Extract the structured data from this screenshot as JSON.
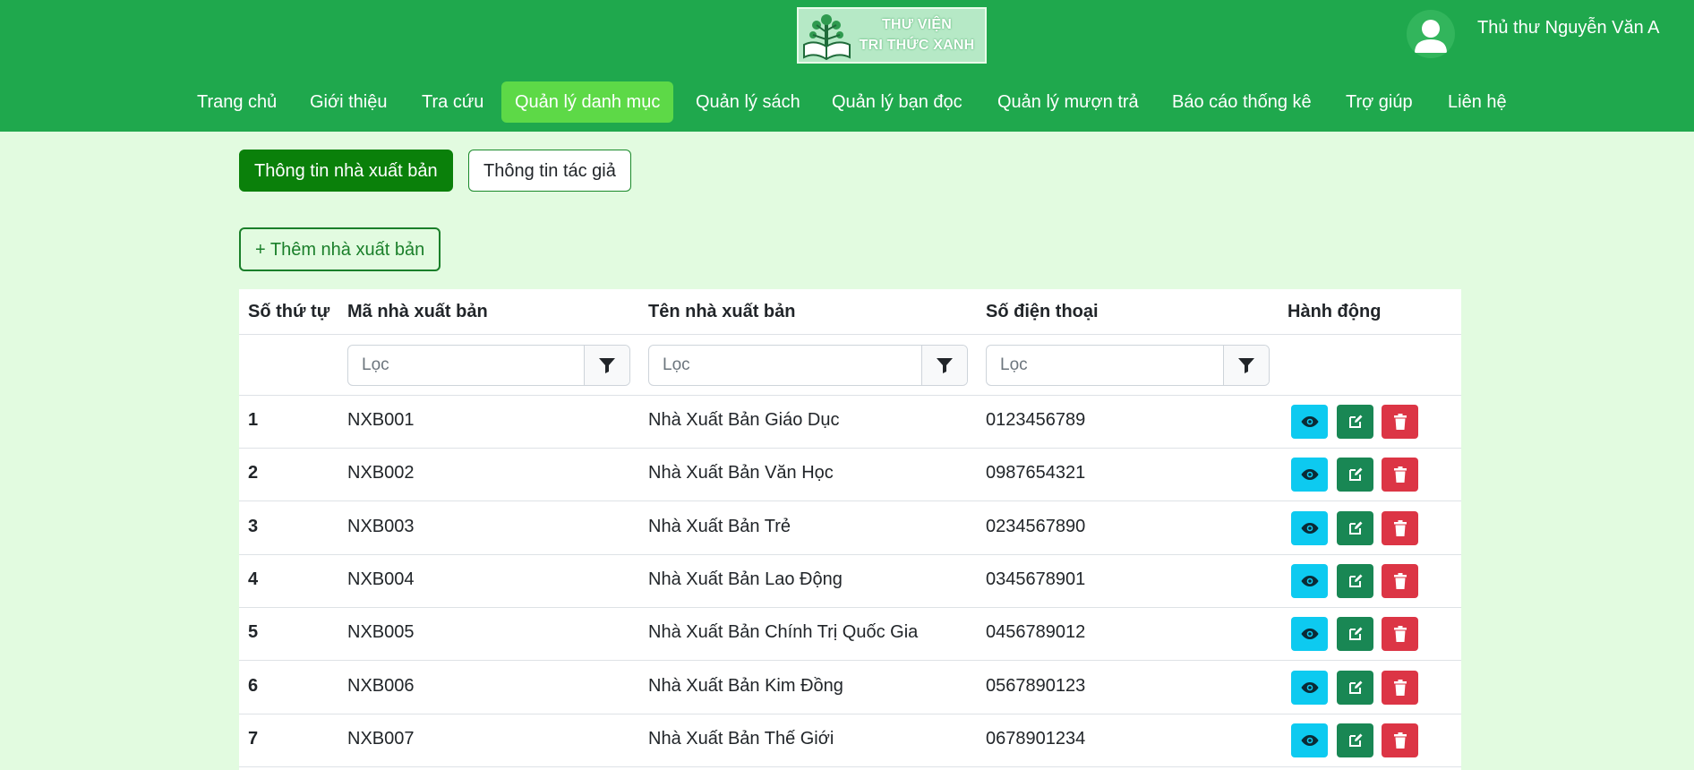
{
  "header": {
    "logo": {
      "line1": "THƯ VIỆN",
      "line2": "TRI THỨC XANH"
    },
    "user_name": "Thủ thư Nguyễn Văn A",
    "nav": [
      {
        "label": "Trang chủ",
        "active": false
      },
      {
        "label": "Giới thiệu",
        "active": false
      },
      {
        "label": "Tra cứu",
        "active": false
      },
      {
        "label": "Quản lý danh mục",
        "active": true
      },
      {
        "label": "Quản lý sách",
        "active": false
      },
      {
        "label": "Quản lý bạn đọc",
        "active": false
      },
      {
        "label": "Quản lý mượn trả",
        "active": false
      },
      {
        "label": "Báo cáo thống kê",
        "active": false
      },
      {
        "label": "Trợ giúp",
        "active": false
      },
      {
        "label": "Liên hệ",
        "active": false
      }
    ]
  },
  "tabs": {
    "publisher_info": "Thông tin nhà xuất bản",
    "author_info": "Thông tin tác giả"
  },
  "add_button": "+ Thêm nhà xuất bản",
  "table": {
    "columns": [
      "Số thứ tự",
      "Mã nhà xuất bản",
      "Tên nhà xuất bản",
      "Số điện thoại",
      "Hành động"
    ],
    "filter_placeholder": "Lọc",
    "rows": [
      {
        "stt": "1",
        "code": "NXB001",
        "name": "Nhà Xuất Bản Giáo Dục",
        "phone": "0123456789"
      },
      {
        "stt": "2",
        "code": "NXB002",
        "name": "Nhà Xuất Bản Văn Học",
        "phone": "0987654321"
      },
      {
        "stt": "3",
        "code": "NXB003",
        "name": "Nhà Xuất Bản Trẻ",
        "phone": "0234567890"
      },
      {
        "stt": "4",
        "code": "NXB004",
        "name": "Nhà Xuất Bản Lao Động",
        "phone": "0345678901"
      },
      {
        "stt": "5",
        "code": "NXB005",
        "name": "Nhà Xuất Bản Chính Trị Quốc Gia",
        "phone": "0456789012"
      },
      {
        "stt": "6",
        "code": "NXB006",
        "name": "Nhà Xuất Bản Kim Đồng",
        "phone": "0567890123"
      },
      {
        "stt": "7",
        "code": "NXB007",
        "name": "Nhà Xuất Bản Thế Giới",
        "phone": "0678901234"
      }
    ]
  },
  "icons": {
    "view": "eye-icon",
    "edit": "edit-icon",
    "delete": "trash-icon",
    "filter": "filter-icon"
  },
  "colors": {
    "header_bg": "#1fa84d",
    "page_bg": "#e2fbe0",
    "nav_active": "#5dd947",
    "tab_active": "#0a800a",
    "view": "#0dcaf0",
    "edit": "#198754",
    "delete": "#dc3545"
  }
}
